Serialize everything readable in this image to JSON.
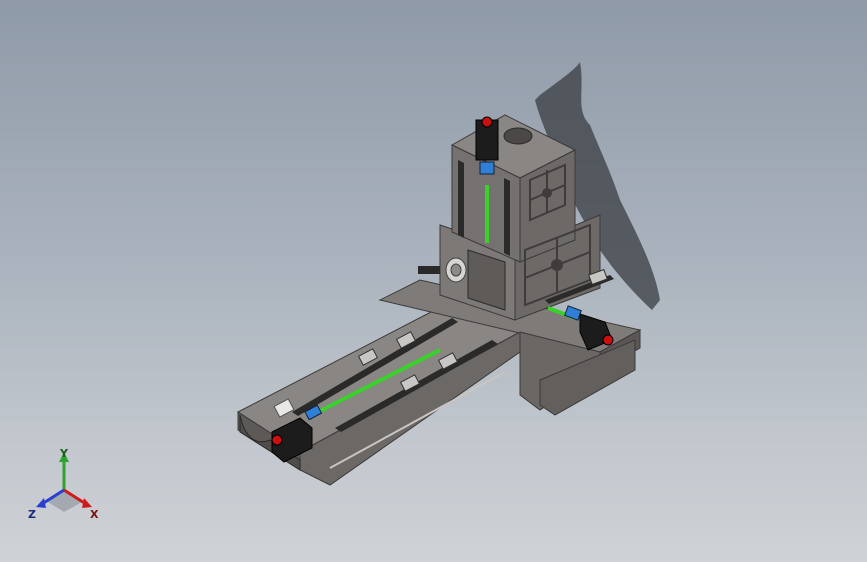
{
  "viewport": {
    "background_top": "#8f9aa8",
    "background_bottom": "#cfd2d6"
  },
  "model": {
    "base_color": "#7b7775",
    "column_color": "#6f6b69",
    "rail_color": "#2a2a2a",
    "screw_color": "#39d12a",
    "motor_color": "#1c1c1c",
    "coupling_color": "#2f7fd6",
    "stop_color": "#c81010"
  },
  "triad": {
    "x_label": "X",
    "y_label": "Y",
    "z_label": "Z",
    "x_color": "#d01a1a",
    "y_color": "#2fa32f",
    "z_color": "#2a3fd0"
  }
}
